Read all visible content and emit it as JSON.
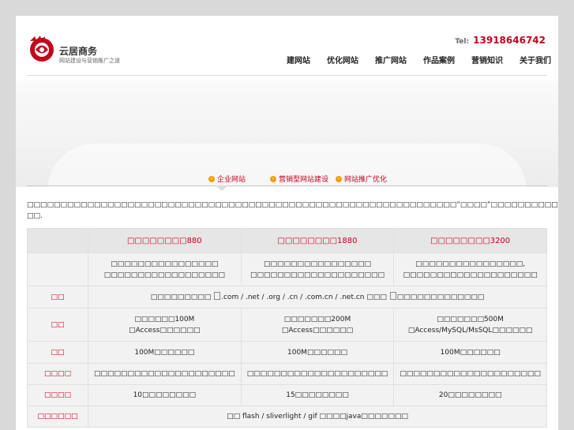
{
  "brand": {
    "name": "云居商务",
    "tagline": "网站建设与营销推广之道",
    "accent": "#c4001d"
  },
  "header": {
    "tel_label": "Tel:",
    "tel_number": "13918646742"
  },
  "nav": {
    "items": [
      "建网站",
      "优化网站",
      "推广网站",
      "作品案例",
      "营销知识",
      "关于我们"
    ]
  },
  "tabs": {
    "items": [
      "企业网站",
      "营销型网站建设",
      "网站推广优化"
    ]
  },
  "intro": {
    "line1": "□□□□□□□□□□□□□□□□□□□□□□□□□□□□□□□□□□□□□□□□□□□□□□□□□□□□□□□□□□□□□□□□”□□□□”□□□□□□□□□□□□□□□□□□□□□□□□□□□□□□□□□□□□□□□□□□",
    "line2": "□□."
  },
  "table": {
    "headers": [
      "",
      "□□□□□□□□880",
      "□□□□□□□□1880",
      "□□□□□□□□3200"
    ],
    "desc_row": [
      [
        "□□□□□□□□□□□□□□□□",
        "□□□□□□□□□□□□□□□□□□"
      ],
      [
        "□□□□□□□□□□□□□□□□",
        "□□□□□□□□□□□□□□□□□□□□"
      ],
      [
        "□□□□□□□□□□□□□□□□,",
        "□□□□□□□□□□□□□□□□□□□□"
      ]
    ],
    "domain_row": {
      "label": "□□",
      "value_prefix": "□□□□□□□□□ ",
      "value_suffix": ".com / .net / .org / .cn / .com.cn / .net.cn □□□ ",
      "value_end": "□□□□□□□□□□□□□"
    },
    "space_row": {
      "label": "□□",
      "cells": [
        [
          "□□□□□□100M",
          "□Access□□□□□□"
        ],
        [
          "□□□□□□□200M",
          "□Access□□□□□□"
        ],
        [
          "□□□□□□□500M",
          "□Access/MySQL/MsSQL□□□□□□"
        ]
      ]
    },
    "mail_row": {
      "label": "□□",
      "cells": [
        "100M□□□□□□",
        "100M□□□□□□",
        "100M□□□□□□"
      ]
    },
    "design_row": {
      "label": "□□□□",
      "cells": [
        "□□□□□□□□□□□□□□□□□□□□□",
        "□□□□□□□□□□□□□□□□□□□□□",
        "□□□□□□□□□□□□□□□□□□□□□"
      ]
    },
    "pages_row": {
      "label": "□□□□",
      "cells": [
        "10□□□□□□□□",
        "15□□□□□□□□",
        "20□□□□□□□□"
      ]
    },
    "effects_row": {
      "label": "□□□□□□",
      "value": "□□ flash / sliverlight / gif □□□□java□□□□□□□"
    }
  }
}
